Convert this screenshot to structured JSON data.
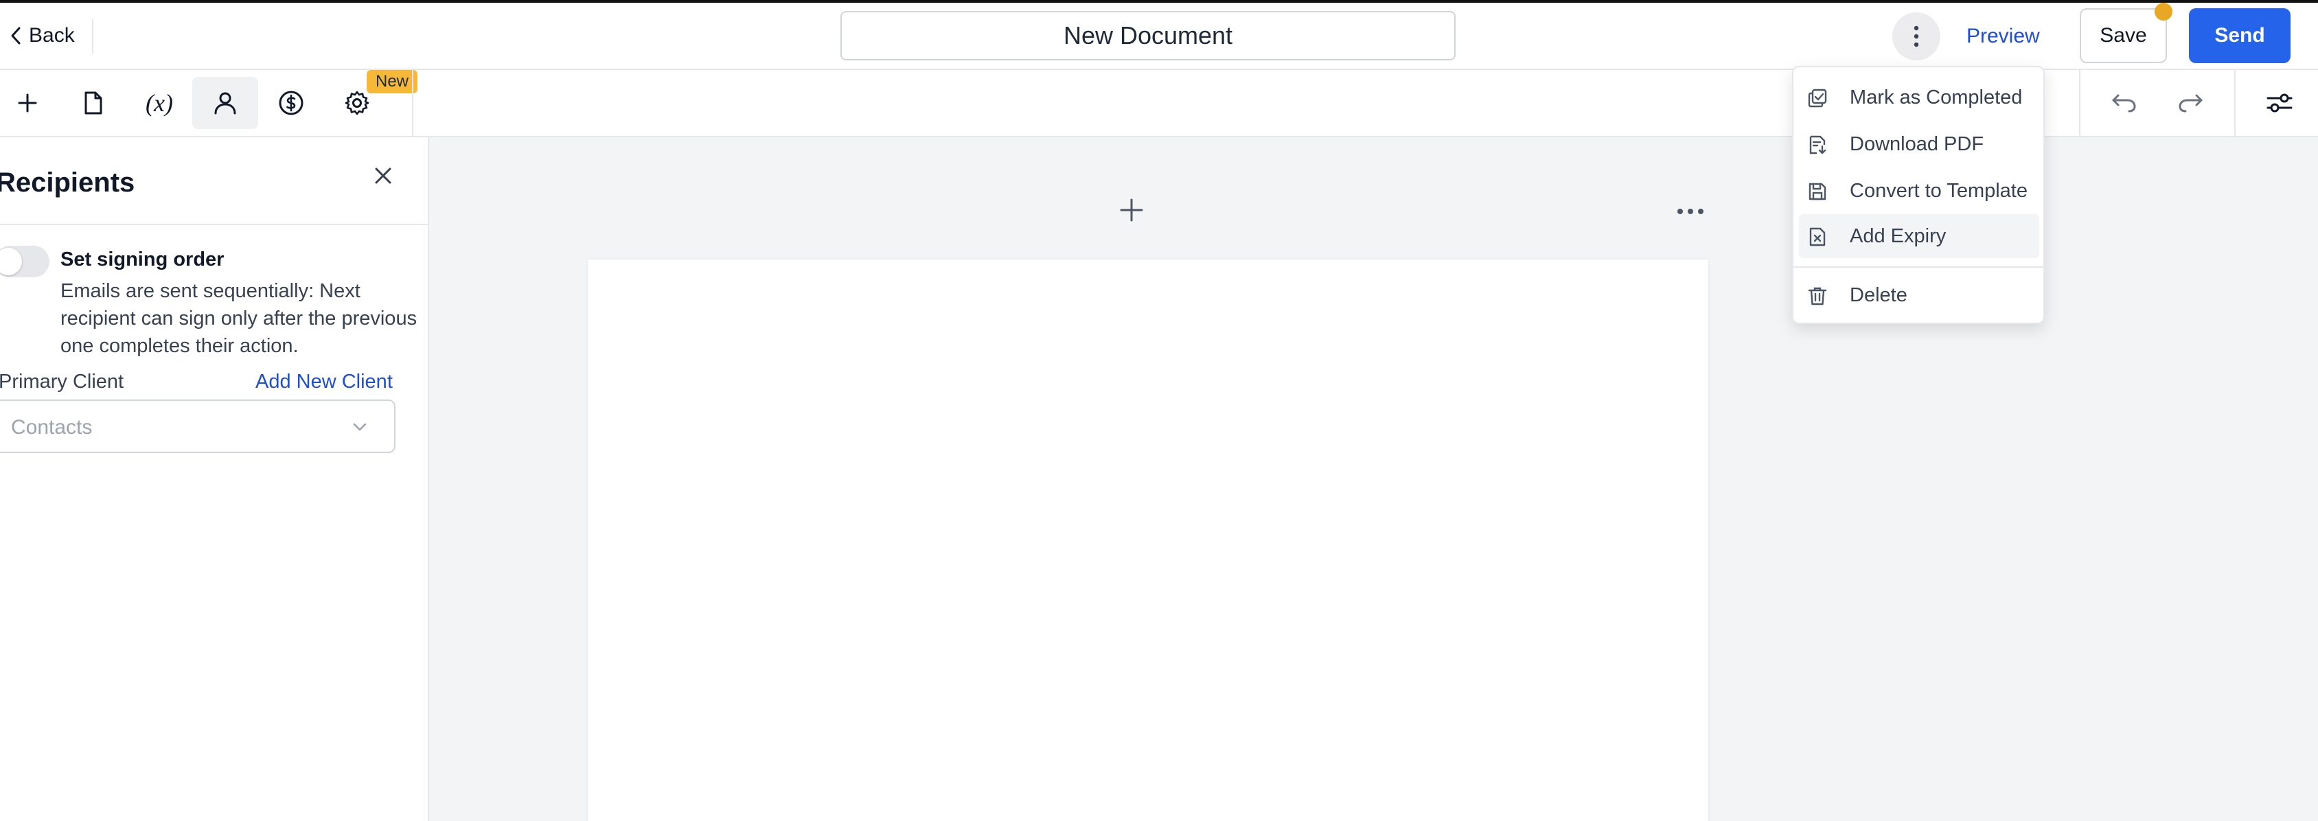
{
  "header": {
    "back_label": "Back",
    "document_title": "New Document",
    "preview_label": "Preview",
    "save_label": "Save",
    "send_label": "Send",
    "accent_color": "#2563eb"
  },
  "toolbar": {
    "tools": [
      {
        "icon": "plus-icon"
      },
      {
        "icon": "document-icon"
      },
      {
        "icon": "variable-icon",
        "label": "(x)"
      },
      {
        "icon": "person-icon",
        "active": true
      },
      {
        "icon": "dollar-icon"
      },
      {
        "icon": "gear-icon"
      }
    ],
    "new_badge": "New",
    "right_tools": [
      {
        "icon": "undo-icon"
      },
      {
        "icon": "redo-icon"
      },
      {
        "icon": "settings-sliders-icon"
      }
    ]
  },
  "recipients": {
    "title": "Recipients",
    "signing_order_title": "Set signing order",
    "signing_order_desc": "Emails are sent sequentially: Next recipient can sign only after the previous one completes their action.",
    "primary_client_label": "Primary Client",
    "add_new_client_label": "Add New Client",
    "contacts_placeholder": "Contacts"
  },
  "menu": {
    "items": [
      {
        "label": "Mark as Completed",
        "icon": "check-copy-icon"
      },
      {
        "label": "Download PDF",
        "icon": "file-download-icon"
      },
      {
        "label": "Convert to Template",
        "icon": "save-icon"
      },
      {
        "label": "Add Expiry",
        "icon": "file-x-icon",
        "hovered": true
      },
      {
        "label": "Delete",
        "icon": "trash-icon"
      }
    ]
  }
}
